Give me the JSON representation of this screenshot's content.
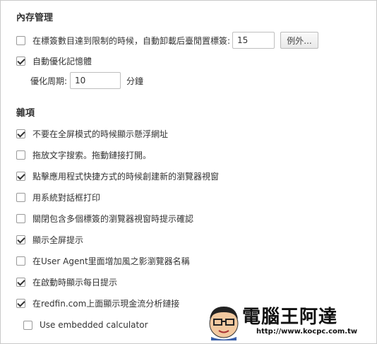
{
  "memory": {
    "title": "內存管理",
    "tab_limit_label": "在標簽數目達到限制的時候，自動卸載后臺閒置標簽:",
    "tab_limit_value": "15",
    "tab_limit_checked": false,
    "exceptions_button": "例外...",
    "auto_optimize_label": "自動優化記憶體",
    "auto_optimize_checked": true,
    "period_label": "優化周期:",
    "period_value": "10",
    "period_unit": "分鐘"
  },
  "misc": {
    "title": "雜項",
    "items": [
      {
        "label": "不要在全屏模式的時候顯示懸浮網址",
        "checked": true
      },
      {
        "label": "拖放文字搜索。拖動鏈接打開。",
        "checked": false
      },
      {
        "label": "點擊應用程式快捷方式的時候創建新的瀏覽器視窗",
        "checked": true
      },
      {
        "label": "用系統對話框打印",
        "checked": false
      },
      {
        "label": "關閉包含多個標簽的瀏覽器視窗時提示確認",
        "checked": false
      },
      {
        "label": "顯示全屏提示",
        "checked": true
      },
      {
        "label": "在User Agent里面增加風之影瀏覽器名稱",
        "checked": false
      },
      {
        "label": "在啟動時顯示每日提示",
        "checked": true
      },
      {
        "label": "在redfin.com上面顯示現金流分析鏈接",
        "checked": true
      }
    ],
    "sub_item": {
      "label": "Use embedded calculator",
      "checked": false
    }
  },
  "watermark": {
    "brand": "電腦王阿達",
    "url": "http://www.kocpc.com.tw"
  }
}
